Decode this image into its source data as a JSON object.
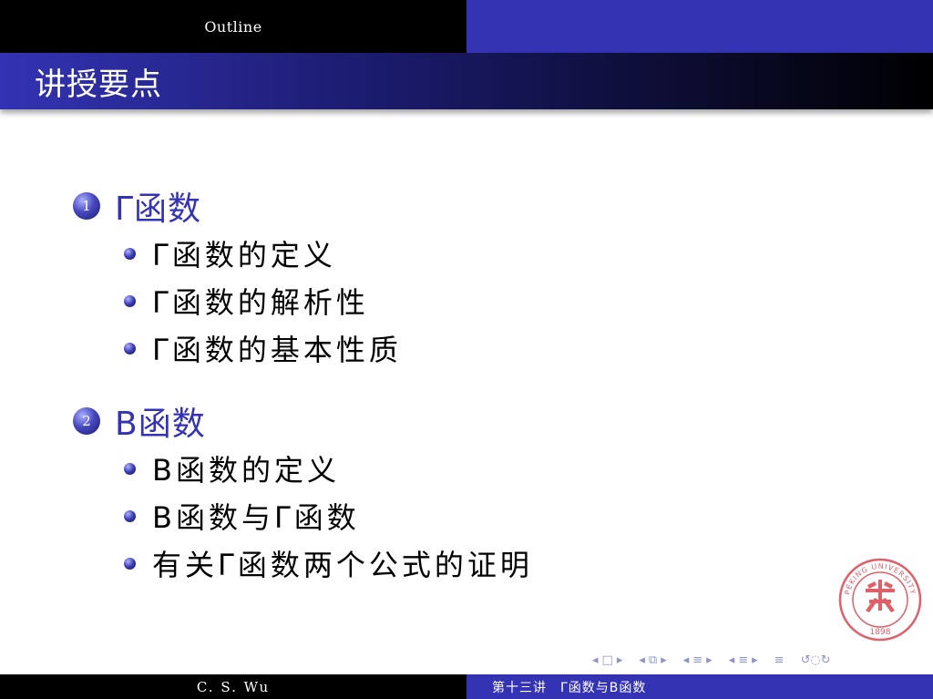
{
  "header": {
    "section_nav": "Outline"
  },
  "frame": {
    "title": "讲授要点"
  },
  "outline": {
    "sections": [
      {
        "number": "1",
        "title": "Γ函数",
        "items": [
          "Γ函数的定义",
          "Γ函数的解析性",
          "Γ函数的基本性质"
        ]
      },
      {
        "number": "2",
        "title": "B函数",
        "items": [
          "B函数的定义",
          "B函数与Γ函数",
          "有关Γ函数两个公式的证明"
        ]
      }
    ]
  },
  "seal": {
    "upper_text": "PEKING UNIVERSITY",
    "year": "1898"
  },
  "nav_symbols": {
    "frame_icons": [
      "◂",
      "□",
      "▸"
    ],
    "subsection_icons": [
      "◂",
      "⧉",
      "▸"
    ],
    "section_icons": [
      "◂",
      "≡",
      "▸"
    ],
    "subsubsection_icons": [
      "◂",
      "≡",
      "▸"
    ],
    "appendix_icon": "≡",
    "search_icon": "↺◌↻"
  },
  "footer": {
    "author": "C. S. Wu",
    "lecture_title": "第十三讲　Γ函数与B函数"
  },
  "colors": {
    "structure_blue": "#3333b3",
    "header_black": "#000000",
    "seal_red": "#e0606a"
  }
}
